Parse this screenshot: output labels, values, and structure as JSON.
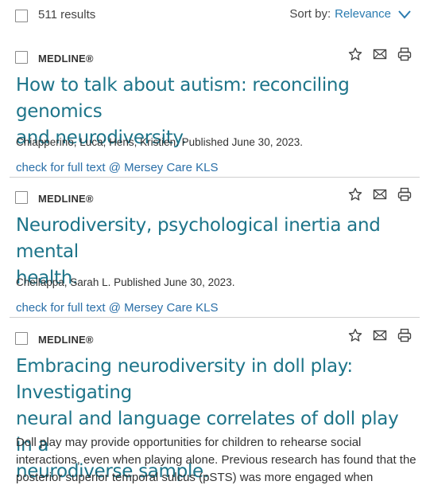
{
  "header": {
    "results": "511 results",
    "sort_label": "Sort by:",
    "sort_value": "Relevance"
  },
  "records": [
    {
      "source": "MEDLINE®",
      "title_lines": [
        "How to talk about autism: reconciling genomics",
        "and neurodiversity."
      ],
      "meta": "Chiapperino, Luca; Hens, Kristien. Published June 30, 2023.",
      "fulltext": "check for full text @ Mersey Care KLS"
    },
    {
      "source": "MEDLINE®",
      "title_lines": [
        "Neurodiversity, psychological inertia and mental",
        "health."
      ],
      "meta": "Chellappa, Sarah L. Published June 30, 2023.",
      "fulltext": "check for full text @ Mersey Care KLS"
    },
    {
      "source": "MEDLINE®",
      "title_lines": [
        "Embracing neurodiversity in doll play: Investigating",
        "neural and language correlates of doll play in a",
        "neurodiverse sample."
      ],
      "abstract_lines": [
        "Doll play may provide opportunities for children to rehearse social",
        "interactions, even when playing alone. Previous research has found that the",
        "posterior superior temporal sulcus (pSTS) was more engaged when children"
      ]
    }
  ],
  "icons": {
    "star": "star-icon",
    "mail": "mail-icon",
    "print": "print-icon",
    "chevron": "chevron-down-icon"
  },
  "colors": {
    "title": "#1d7489",
    "link": "#2a6fa8",
    "sort_value": "#2a7bb0"
  }
}
